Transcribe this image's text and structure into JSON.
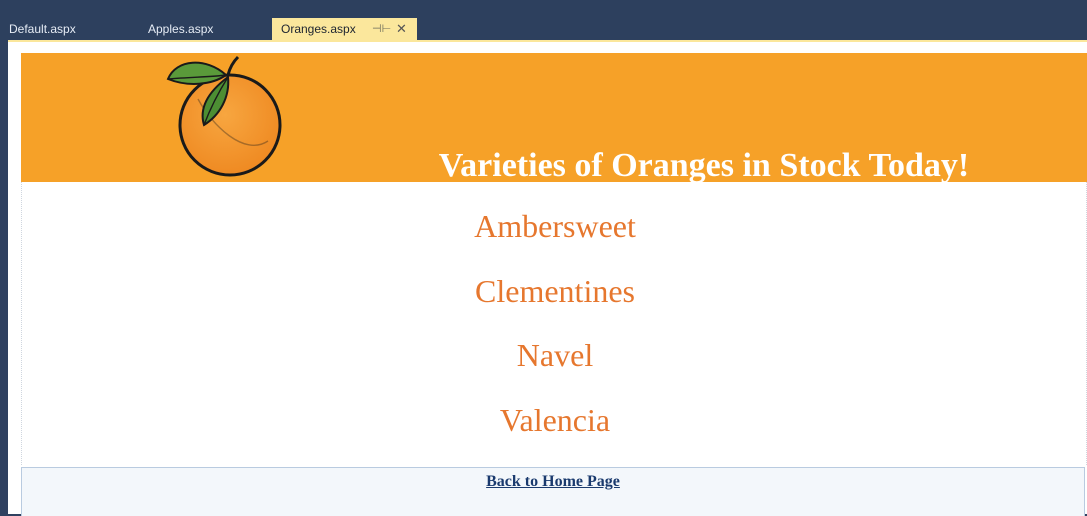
{
  "tabs": [
    {
      "label": "Default.aspx",
      "active": false
    },
    {
      "label": "Apples.aspx",
      "active": false
    },
    {
      "label": "Oranges.aspx",
      "active": true
    }
  ],
  "tab_icons": {
    "pin": "pin-icon",
    "close": "close-icon"
  },
  "header": {
    "logo": "orange-fruit-icon",
    "title": "Varieties of Oranges in Stock Today!"
  },
  "varieties": [
    "Ambersweet",
    "Clementines",
    "Navel",
    "Valencia"
  ],
  "footer": {
    "link_label": "Back to Home Page"
  },
  "colors": {
    "banner": "#f6a128",
    "variety_text": "#e6772e",
    "active_tab": "#fbe79c",
    "tab_bar": "#2d405e",
    "link": "#1a3a6e"
  }
}
